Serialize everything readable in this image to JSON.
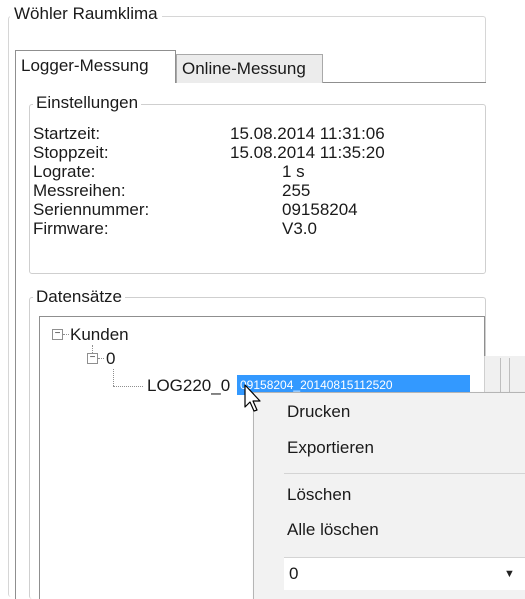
{
  "window": {
    "title": "Wöhler Raumklima"
  },
  "tabs": [
    {
      "label": "Logger-Messung",
      "active": true
    },
    {
      "label": "Online-Messung",
      "active": false
    }
  ],
  "settings": {
    "title": "Einstellungen",
    "rows": [
      {
        "label": "Startzeit:",
        "value": "15.08.2014 11:31:06"
      },
      {
        "label": "Stoppzeit:",
        "value": "15.08.2014 11:35:20"
      },
      {
        "label": "Lograte:",
        "value": "1 s"
      },
      {
        "label": "Messreihen:",
        "value": "255"
      },
      {
        "label": "Seriennummer:",
        "value": "09158204"
      },
      {
        "label": "Firmware:",
        "value": "V3.0"
      }
    ]
  },
  "datasets": {
    "title": "Datensätze",
    "tree": {
      "root": {
        "label": "Kunden",
        "expander": "−"
      },
      "child": {
        "label": "0",
        "expander": "−"
      },
      "leaf": {
        "label_prefix": "LOG220_0",
        "selected_text": "09158204_20140815112520"
      }
    }
  },
  "context_menu": {
    "items": [
      "Drucken",
      "Exportieren",
      "Löschen",
      "Alle löschen"
    ],
    "combo": {
      "value": "0",
      "arrow": "▼"
    }
  },
  "colors": {
    "selection": "#3399ff",
    "menu_bg": "#f2f2f2"
  }
}
